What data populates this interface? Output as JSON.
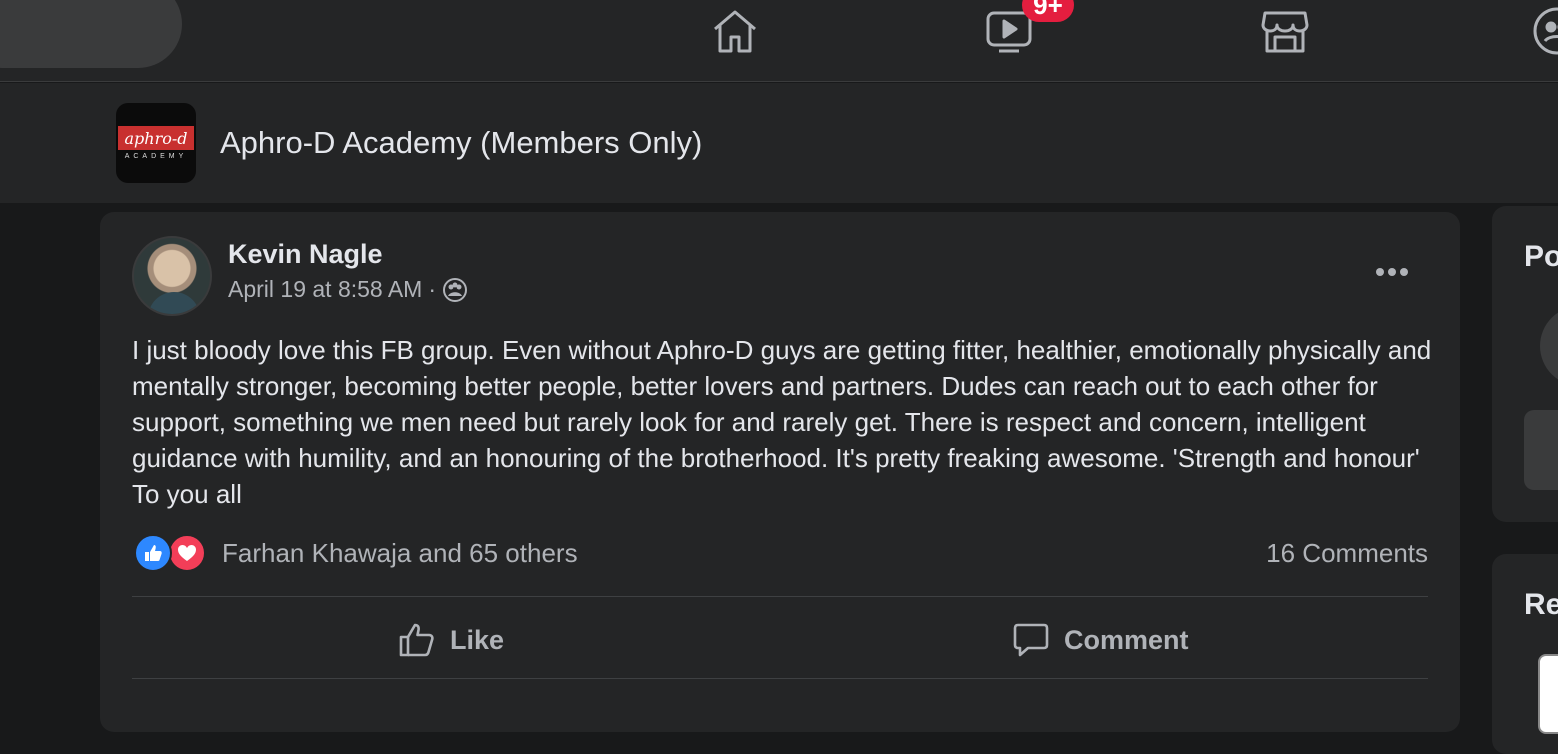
{
  "topbar": {
    "nav_icons": [
      "home-icon",
      "watch-icon",
      "marketplace-icon",
      "groups-icon"
    ],
    "watch_badge": "9+"
  },
  "group": {
    "logo_text": "aphro-d",
    "logo_subtext": "ACADEMY",
    "title": "Aphro-D Academy (Members Only)"
  },
  "post": {
    "author": "Kevin Nagle",
    "timestamp": "April 19 at 8:58 AM",
    "separator": "·",
    "privacy_icon": "members-icon",
    "text": "I just bloody love this FB group. Even without Aphro-D guys are getting fitter, healthier, emotionally physically and mentally stronger, becoming better people, better lovers and partners. Dudes can reach out to each other for support, something we men need but rarely look for and rarely get. There is respect and concern, intelligent guidance with humility, and an honouring of the brotherhood. It's pretty freaking awesome. 'Strength and honour' To you all",
    "reactions_summary": "Farhan Khawaja and 65 others",
    "reaction_types": [
      "like",
      "love"
    ],
    "comments_count": "16 Comments",
    "actions": {
      "like_label": "Like",
      "comment_label": "Comment"
    }
  },
  "sidebar": {
    "card1_title_partial": "Po",
    "card2_title_partial": "Re"
  },
  "colors": {
    "background": "#18191a",
    "surface": "#242526",
    "text_primary": "#e4e6eb",
    "text_secondary": "#b0b3b8",
    "badge_red": "#e41e3f",
    "like_blue": "#2d88ff",
    "love_red": "#f33e58"
  }
}
